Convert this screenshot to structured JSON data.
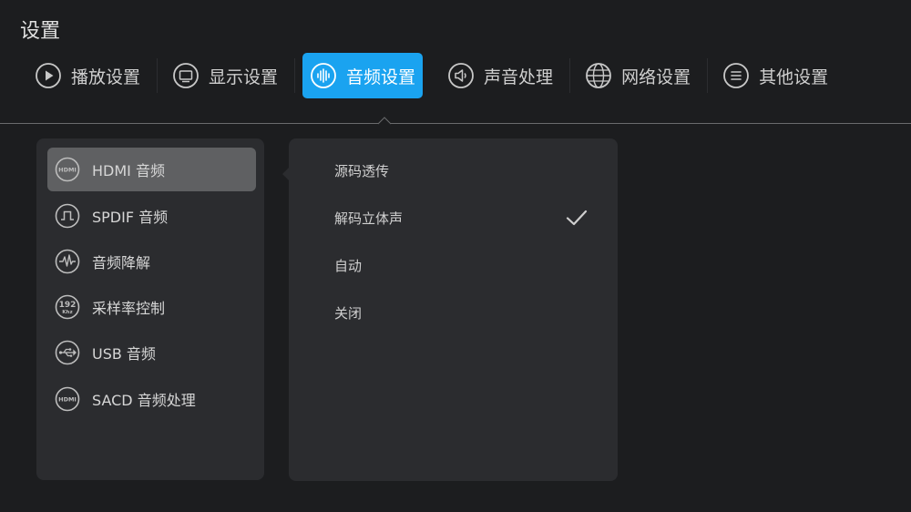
{
  "page": {
    "title": "设置"
  },
  "tabs": [
    {
      "label": "播放设置",
      "icon": "play-icon",
      "active": false
    },
    {
      "label": "显示设置",
      "icon": "monitor-icon",
      "active": false
    },
    {
      "label": "音频设置",
      "icon": "audio-wave-icon",
      "active": true
    },
    {
      "label": "声音处理",
      "icon": "speaker-icon",
      "active": false
    },
    {
      "label": "网络设置",
      "icon": "globe-icon",
      "active": false
    },
    {
      "label": "其他设置",
      "icon": "menu-lines-icon",
      "active": false
    }
  ],
  "menu": [
    {
      "label": "HDMI 音频",
      "icon": "hdmi-icon",
      "icon_text": "HDMI",
      "selected": true
    },
    {
      "label": "SPDIF 音频",
      "icon": "square-wave-icon",
      "selected": false
    },
    {
      "label": "音频降解",
      "icon": "waveform-icon",
      "selected": false
    },
    {
      "label": "采样率控制",
      "icon": "sample-rate-icon",
      "icon_text": "192",
      "icon_subtext": "Khz",
      "selected": false
    },
    {
      "label": "USB 音频",
      "icon": "usb-icon",
      "selected": false
    },
    {
      "label": "SACD 音频处理",
      "icon": "hdmi-icon",
      "icon_text": "HDMI",
      "selected": false
    }
  ],
  "options": [
    {
      "label": "源码透传",
      "checked": false
    },
    {
      "label": "解码立体声",
      "checked": true
    },
    {
      "label": "自动",
      "checked": false
    },
    {
      "label": "关闭",
      "checked": false
    }
  ],
  "colors": {
    "accent": "#1aa3f0",
    "background": "#1c1d1f",
    "panel": "#2b2c2f",
    "selected_item": "#5f6062"
  }
}
